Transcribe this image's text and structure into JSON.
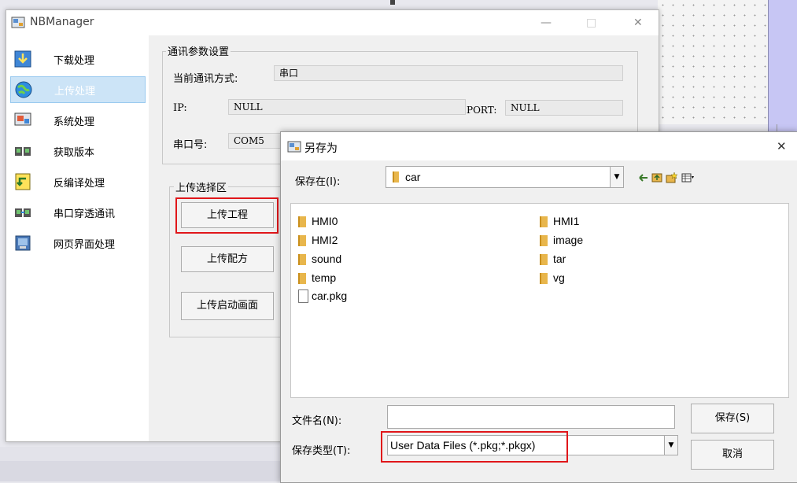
{
  "main_window": {
    "title": "NBManager",
    "controls": {
      "minimize": "—",
      "maximize": "□",
      "close": "✕"
    }
  },
  "sidebar": {
    "items": [
      {
        "label": "下载处理",
        "icon": "download-icon",
        "selected": false
      },
      {
        "label": "上传处理",
        "icon": "upload-globe-icon",
        "selected": true
      },
      {
        "label": "系统处理",
        "icon": "system-icon",
        "selected": false
      },
      {
        "label": "获取版本",
        "icon": "version-icon",
        "selected": false
      },
      {
        "label": "反编译处理",
        "icon": "decompile-icon",
        "selected": false
      },
      {
        "label": "串口穿透通讯",
        "icon": "serial-passthrough-icon",
        "selected": false
      },
      {
        "label": "网页界面处理",
        "icon": "web-page-icon",
        "selected": false
      }
    ]
  },
  "comm_settings": {
    "group_label": "通讯参数设置",
    "mode_label": "当前通讯方式:",
    "mode_value": "串口",
    "ip_label": "IP:",
    "ip_value": "NULL",
    "port_label": "PORT:",
    "port_value": "NULL",
    "serial_label": "串口号:",
    "serial_value": "COM5"
  },
  "upload_area": {
    "group_label": "上传选择区",
    "buttons": [
      "上传工程",
      "上传配方",
      "上传启动画面"
    ]
  },
  "save_dialog": {
    "title": "另存为",
    "close": "✕",
    "save_in_label": "保存在(I):",
    "save_in_value": "car",
    "files": [
      {
        "name": "HMI0",
        "type": "folder"
      },
      {
        "name": "HMI2",
        "type": "folder"
      },
      {
        "name": "sound",
        "type": "folder"
      },
      {
        "name": "temp",
        "type": "folder"
      },
      {
        "name": "car.pkg",
        "type": "file"
      },
      {
        "name": "HMI1",
        "type": "folder"
      },
      {
        "name": "image",
        "type": "folder"
      },
      {
        "name": "tar",
        "type": "folder"
      },
      {
        "name": "vg",
        "type": "folder"
      }
    ],
    "filename_label": "文件名(N):",
    "filename_value": "",
    "filetype_label": "保存类型(T):",
    "filetype_value": "User Data Files (*.pkg;*.pkgx)",
    "save_button": "保存(S)",
    "cancel_button": "取消"
  },
  "colors": {
    "highlight_red": "#e0161a",
    "selection_blue": "#cce4f7",
    "folder_yellow": "#e8b64c"
  }
}
